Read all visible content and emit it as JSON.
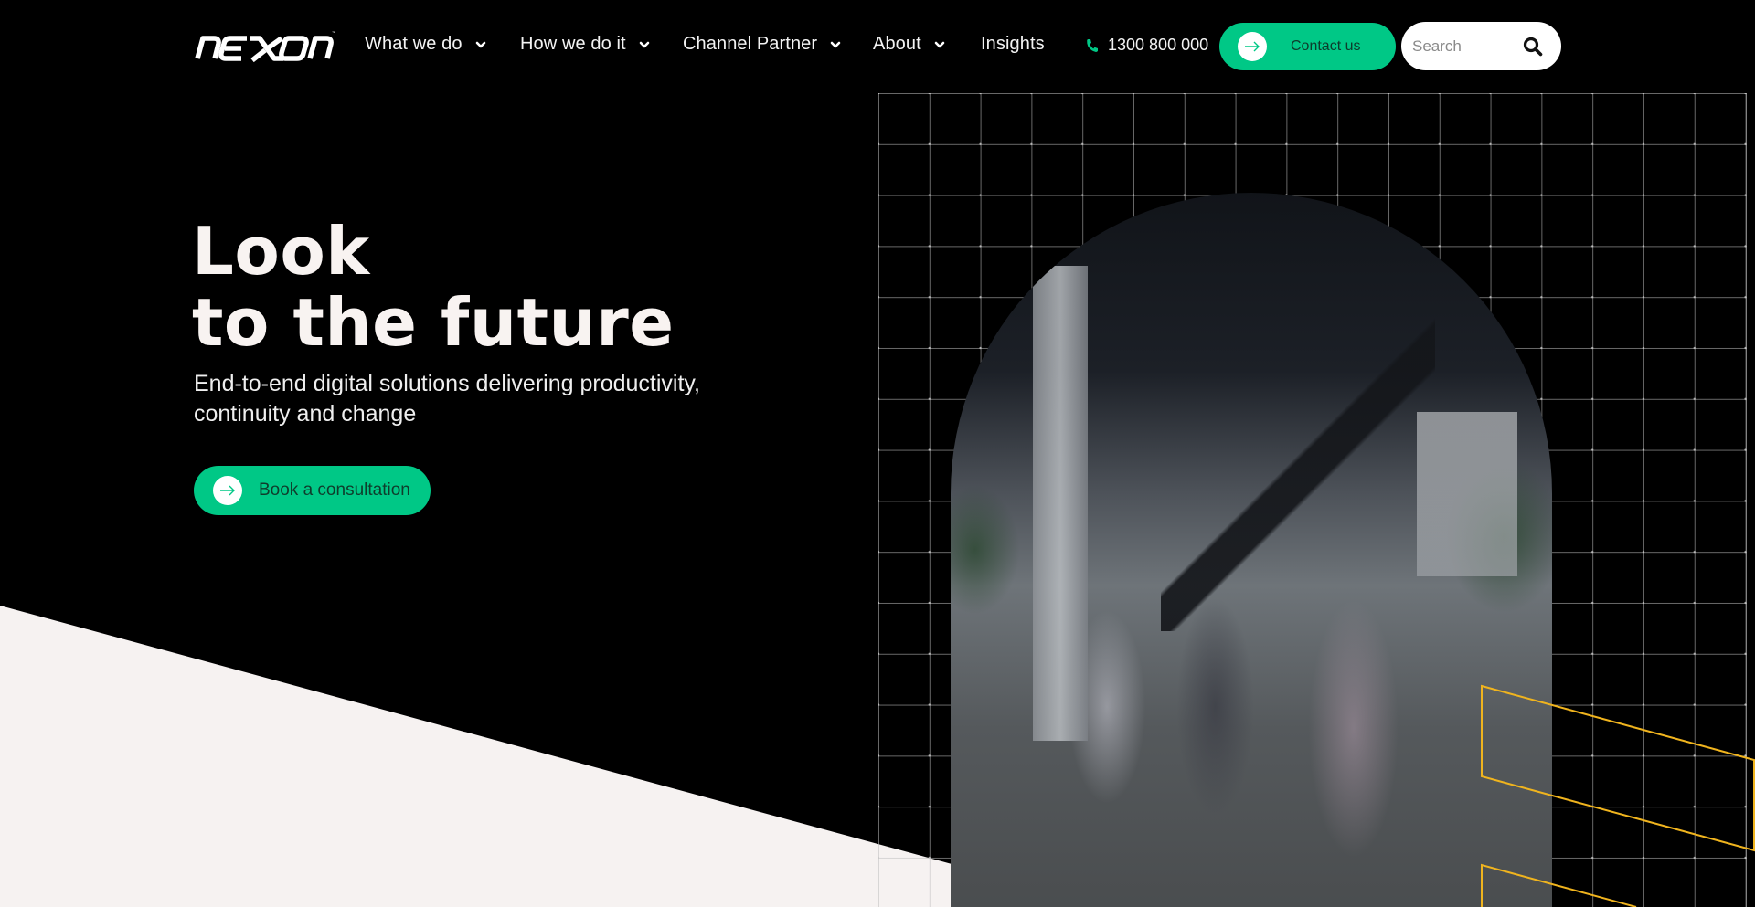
{
  "header": {
    "logo": {
      "name": "nexon",
      "text": "nexon"
    },
    "nav": [
      {
        "label": "What we do",
        "has_dropdown": true
      },
      {
        "label": "How we do it",
        "has_dropdown": true
      },
      {
        "label": "Channel Partner",
        "has_dropdown": true
      },
      {
        "label": "About",
        "has_dropdown": true
      },
      {
        "label": "Insights",
        "has_dropdown": false
      }
    ],
    "phone": {
      "icon": "phone-icon",
      "number": "1300 800 000"
    },
    "contact_button": {
      "label": "Contact us",
      "icon": "arrow-right-icon"
    },
    "search": {
      "placeholder": "Search",
      "value": "",
      "icon": "search-icon"
    }
  },
  "hero": {
    "title_line1": "Look",
    "title_line2": "to the future",
    "subtitle": "End-to-end digital solutions delivering productivity, continuity and change",
    "cta": {
      "label": "Book a consultation",
      "icon": "arrow-right-icon"
    }
  },
  "theme": {
    "background": "#000000",
    "accent_green": "#00c886",
    "accent_yellow": "#f0b41e",
    "light_panel": "#f6f2f1",
    "text": "#f8f3f1"
  },
  "media": {
    "hero_image": "blurred people walking through industrial office with staircase and plants"
  }
}
